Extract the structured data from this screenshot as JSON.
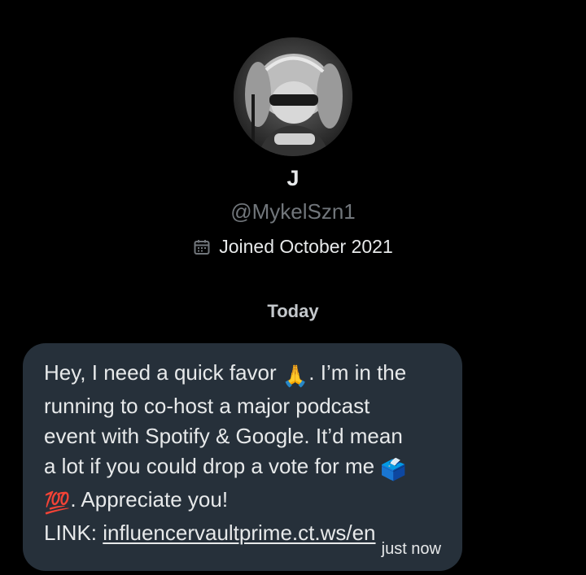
{
  "profile": {
    "avatar_icon": "anime-character-avatar",
    "display_name": "J",
    "handle": "@MykelSzn1",
    "joined_icon": "calendar-icon",
    "joined_text": "Joined October 2021"
  },
  "conversation": {
    "day_label": "Today",
    "messages": [
      {
        "line1_a": "Hey, I need a quick favor ",
        "emoji_pray": "🙏",
        "line1_b": ". I’m in the",
        "line2": "running to co-host a major podcast",
        "line3": "event with Spotify & Google. It’d mean",
        "line4_a": "a lot if you could drop a vote for me ",
        "emoji_ballot": "🗳️",
        "emoji_hundred": "💯",
        "line5_b": ". Appreciate you!",
        "link_prefix": "LINK: ",
        "link_text": "influencervaultprime.ct.ws/en",
        "timestamp": "just now"
      }
    ]
  },
  "colors": {
    "background": "#000000",
    "bubble": "#26303a",
    "text_primary": "#e7e9ea",
    "text_secondary": "#71767b"
  }
}
